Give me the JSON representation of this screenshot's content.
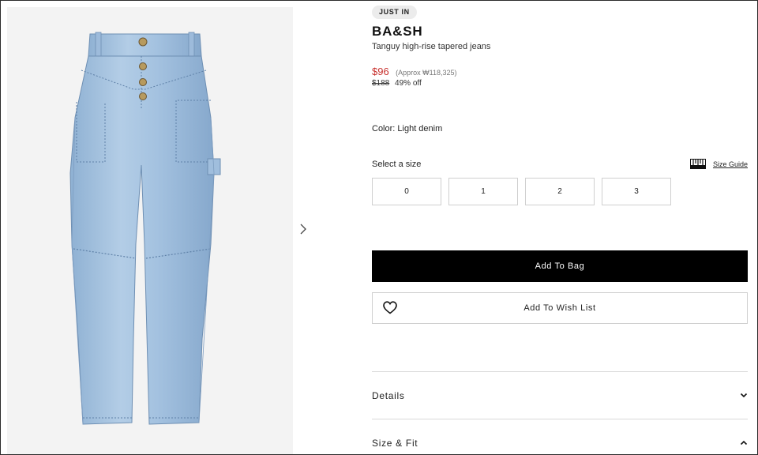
{
  "product": {
    "badge": "JUST IN",
    "brand": "BA&SH",
    "name": "Tanguy high-rise tapered jeans",
    "price": "$96",
    "approx_price": "(Approx ₩118,325)",
    "original_price": "$188",
    "discount": "49% off",
    "color_label": "Color: Light denim"
  },
  "sizes": {
    "label": "Select a size",
    "guide_label": "Size Guide",
    "options": [
      "0",
      "1",
      "2",
      "3"
    ]
  },
  "actions": {
    "add_to_bag": "Add To Bag",
    "add_to_wishlist": "Add To Wish List"
  },
  "accordion": {
    "details": "Details",
    "size_fit": "Size & Fit"
  },
  "colors": {
    "price_red": "#c8312e",
    "button_black": "#000000",
    "denim": "#a9c6e2"
  },
  "icons": {
    "next": "chevron-right-icon",
    "guide": "ruler-icon",
    "wishlist": "heart-icon",
    "details_toggle": "chevron-down-icon",
    "size_toggle": "chevron-up-icon"
  }
}
